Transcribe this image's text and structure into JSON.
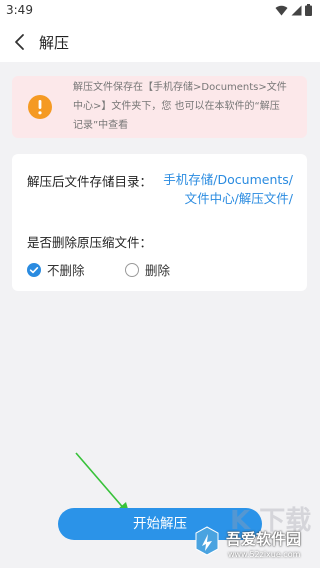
{
  "status_bar": {
    "time": "3:49"
  },
  "nav": {
    "title": "解压"
  },
  "notice": {
    "lines": [
      "解压文件保存在【手机存储>Documents>文件",
      "中心>】文件夹下，您 也可以在本软件的“解压",
      "记录”中查看"
    ]
  },
  "save_path": {
    "label": "解压后文件存储目录：",
    "value_lines": [
      "手机存储/Documents/",
      "文件中心/解压文件/"
    ]
  },
  "delete_option": {
    "label": "是否删除原压缩文件：",
    "options": [
      {
        "label": "不删除",
        "checked": true
      },
      {
        "label": "删除",
        "checked": false
      }
    ]
  },
  "start_button": {
    "label": "开始解压"
  },
  "watermark": {
    "title": "吾爱软件园",
    "url": "www.52zixue.com",
    "big_text": "K 下载"
  },
  "colors": {
    "accent": "#2b93e8",
    "notice_bg": "#fce8ea",
    "warning": "#f59a23"
  }
}
